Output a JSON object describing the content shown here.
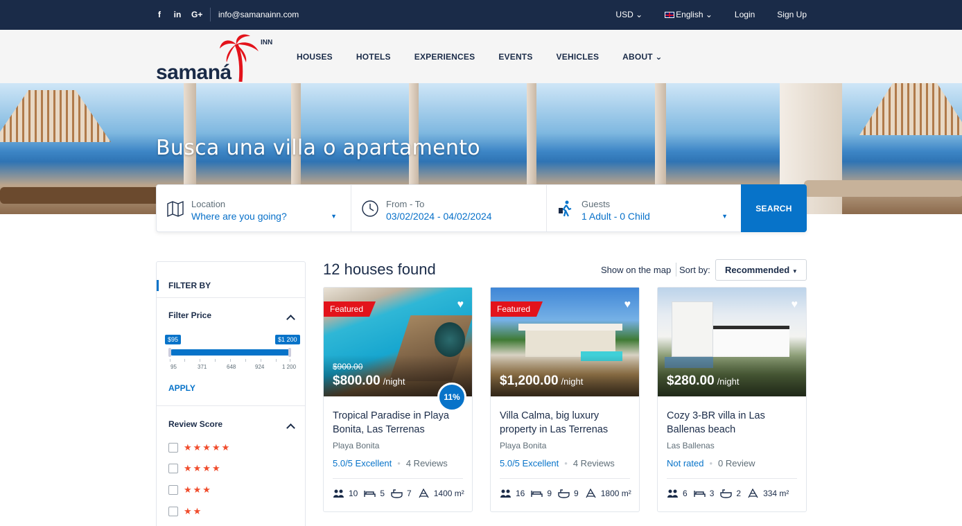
{
  "topbar": {
    "social": [
      "f",
      "in",
      "G+"
    ],
    "email": "info@samanainn.com",
    "currency": "USD",
    "language": "English",
    "login": "Login",
    "signup": "Sign Up"
  },
  "header": {
    "logo_word": "samaná",
    "logo_sup": "INN",
    "nav": [
      "HOUSES",
      "HOTELS",
      "EXPERIENCES",
      "EVENTS",
      "VEHICLES",
      "ABOUT"
    ]
  },
  "hero": {
    "title": "Busca una villa o apartamento"
  },
  "search": {
    "location_label": "Location",
    "location_value": "Where are you going?",
    "dates_label": "From - To",
    "dates_value": "03/02/2024 - 04/02/2024",
    "guests_label": "Guests",
    "guests_value": "1 Adult - 0 Child",
    "button": "SEARCH"
  },
  "sidebar": {
    "filter_by": "FILTER BY",
    "price_title": "Filter Price",
    "price_min": "$95",
    "price_max": "$1 200",
    "ticks": [
      "95",
      "371",
      "648",
      "924",
      "1 200"
    ],
    "apply": "APPLY",
    "review_title": "Review Score",
    "review_rows": [
      "★★★★★",
      "★★★★",
      "★★★",
      "★★"
    ]
  },
  "results": {
    "count_text": "12 houses found",
    "map_link": "Show on the map",
    "sort_label": "Sort by:",
    "sort_value": "Recommended"
  },
  "cards": [
    {
      "featured": "Featured",
      "old_price": "$900.00",
      "price": "$800.00",
      "per": "/night",
      "discount": "11%",
      "title": "Tropical Paradise in Playa Bonita, Las Terrenas",
      "location": "Playa Bonita",
      "rating": "5.0/5 Excellent",
      "reviews": "4 Reviews",
      "guests": "10",
      "beds": "5",
      "baths": "7",
      "area": "1400 m²"
    },
    {
      "featured": "Featured",
      "price": "$1,200.00",
      "per": "/night",
      "title": "Villa Calma, big luxury property in Las Terrenas",
      "location": "Playa Bonita",
      "rating": "5.0/5 Excellent",
      "reviews": "4 Reviews",
      "guests": "16",
      "beds": "9",
      "baths": "9",
      "area": "1800 m²"
    },
    {
      "price": "$280.00",
      "per": "/night",
      "title": "Cozy 3-BR villa in Las Ballenas beach",
      "location": "Las Ballenas",
      "rating": "Not rated",
      "reviews": "0 Review",
      "guests": "6",
      "beds": "3",
      "baths": "2",
      "area": "334 m²"
    }
  ],
  "colors": {
    "navy": "#1a2b48",
    "accent": "#0773c9",
    "featured": "#e3131b",
    "star": "#f04c2c"
  }
}
